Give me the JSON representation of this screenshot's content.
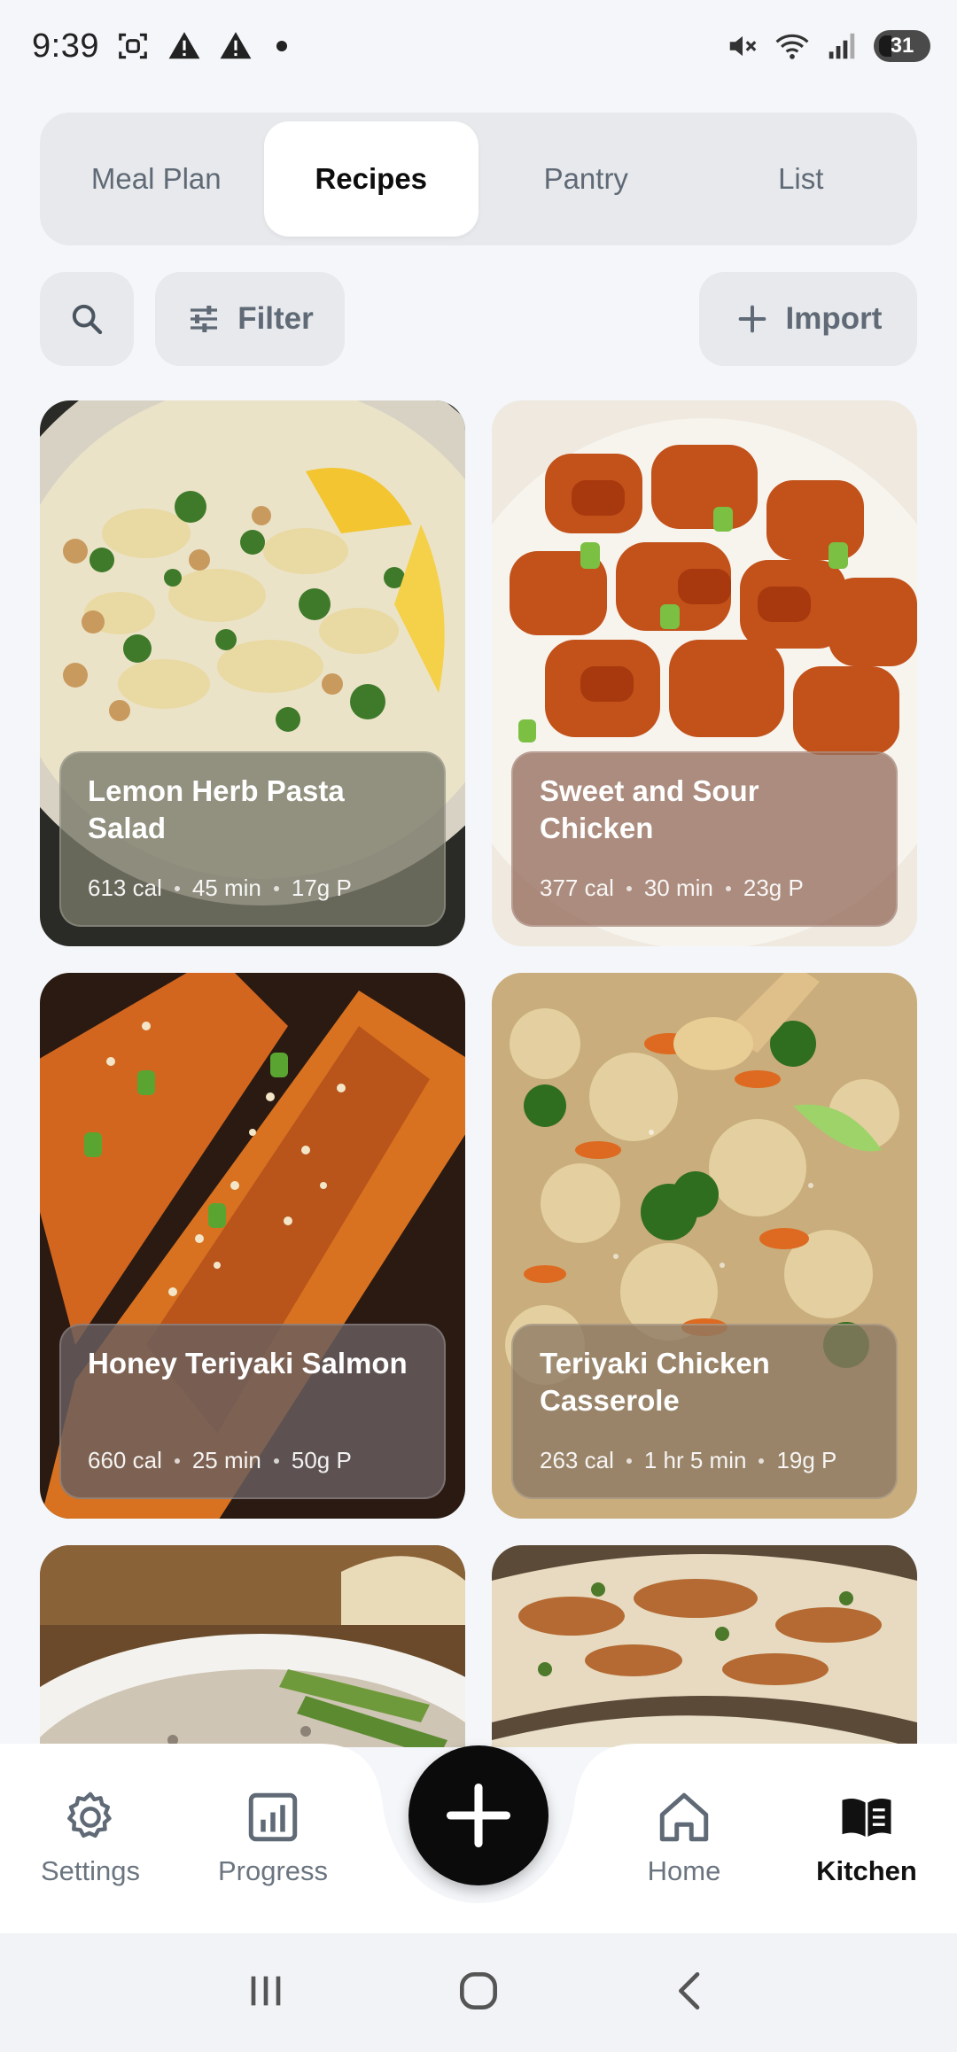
{
  "status_bar": {
    "time": "9:39",
    "left_icons": [
      "screenshot-icon",
      "warning-icon",
      "warning-icon",
      "dot-icon"
    ],
    "right_icons": [
      "mute-icon",
      "wifi-icon",
      "signal-icon"
    ],
    "battery": "31"
  },
  "tabs": [
    {
      "label": "Meal Plan",
      "active": false
    },
    {
      "label": "Recipes",
      "active": true
    },
    {
      "label": "Pantry",
      "active": false
    },
    {
      "label": "List",
      "active": false
    }
  ],
  "toolbar": {
    "search_icon": "search-icon",
    "filter_label": "Filter",
    "import_label": "Import"
  },
  "recipes": [
    {
      "name": "Lemon Herb Pasta Salad",
      "cal": "613 cal",
      "time": "45 min",
      "protein": "17g P"
    },
    {
      "name": "Sweet and Sour Chicken",
      "cal": "377 cal",
      "time": "30 min",
      "protein": "23g P"
    },
    {
      "name": "Honey Teriyaki Salmon",
      "cal": "660 cal",
      "time": "25 min",
      "protein": "50g P"
    },
    {
      "name": "Teriyaki Chicken Casserole",
      "cal": "263 cal",
      "time": "1 hr 5 min",
      "protein": "19g P"
    }
  ],
  "bottom_nav": [
    {
      "label": "Settings",
      "icon": "gear-icon",
      "active": false
    },
    {
      "label": "Progress",
      "icon": "chart-icon",
      "active": false
    },
    {
      "label": "Home",
      "icon": "home-icon",
      "active": false
    },
    {
      "label": "Kitchen",
      "icon": "book-icon",
      "active": true
    }
  ],
  "fab_icon": "plus-icon",
  "system_nav": [
    "recents-icon",
    "home-circle-icon",
    "back-icon"
  ]
}
